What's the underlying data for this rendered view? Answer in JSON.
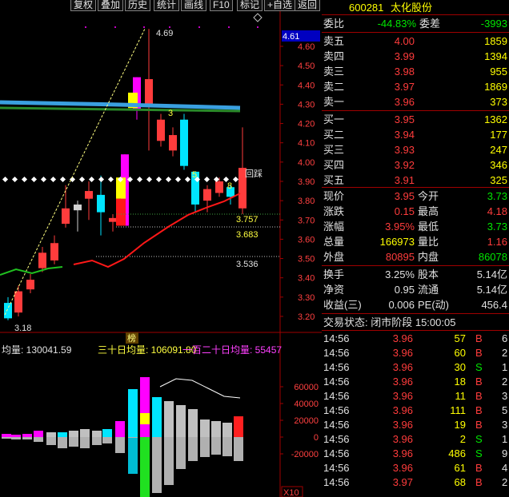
{
  "toolbar": {
    "buttons": [
      "复权",
      "叠加",
      "历史",
      "统计",
      "画线",
      "F10",
      "标记",
      "+自选",
      "返回"
    ]
  },
  "stock": {
    "code": "600281",
    "name": "太化股份",
    "zoom_badge": "4.61"
  },
  "chart": {
    "price_ticks": [
      "4.60",
      "4.50",
      "4.40",
      "4.30",
      "4.20",
      "4.10",
      "4.00",
      "3.90",
      "3.80",
      "3.70",
      "3.60",
      "3.50",
      "3.40",
      "3.30",
      "3.20"
    ],
    "annot_high": "4.69",
    "annot_low": "3.18",
    "annot_levels": [
      "3.757",
      "3.683",
      "3.536"
    ],
    "annot_counts": [
      "3",
      "5",
      "8"
    ],
    "annot_retest": "回踩",
    "marker": "榜",
    "volume_header": {
      "avg_label": "均量: 130041.59",
      "avg30_label": "三十日均量: 106091.80",
      "avg120_label": "一百二十日均量: 55457"
    },
    "volume_ticks": [
      "60000",
      "40000",
      "20000",
      "0",
      "-20000"
    ],
    "scale_badge": "X10"
  },
  "quote": {
    "weibi_label": "委比",
    "weibi_value": "-44.83%",
    "weicha_label": "委差",
    "weicha_value": "-3993",
    "asks": [
      {
        "label": "卖五",
        "price": "4.00",
        "vol": "1859"
      },
      {
        "label": "卖四",
        "price": "3.99",
        "vol": "1394"
      },
      {
        "label": "卖三",
        "price": "3.98",
        "vol": "955"
      },
      {
        "label": "卖二",
        "price": "3.97",
        "vol": "1869"
      },
      {
        "label": "卖一",
        "price": "3.96",
        "vol": "373"
      }
    ],
    "bids": [
      {
        "label": "买一",
        "price": "3.95",
        "vol": "1362"
      },
      {
        "label": "买二",
        "price": "3.94",
        "vol": "177"
      },
      {
        "label": "买三",
        "price": "3.93",
        "vol": "247"
      },
      {
        "label": "买四",
        "price": "3.92",
        "vol": "346"
      },
      {
        "label": "买五",
        "price": "3.91",
        "vol": "325"
      }
    ],
    "stats": [
      {
        "l1": "现价",
        "v1": "3.95",
        "l2": "今开",
        "v2": "3.73"
      },
      {
        "l1": "涨跌",
        "v1": "0.15",
        "l2": "最高",
        "v2": "4.18"
      },
      {
        "l1": "涨幅",
        "v1": "3.95%",
        "l2": "最低",
        "v2": "3.73"
      },
      {
        "l1": "总量",
        "v1": "166973",
        "l2": "量比",
        "v2": "1.16"
      },
      {
        "l1": "外盘",
        "v1": "80895",
        "l2": "内盘",
        "v2": "86078"
      }
    ],
    "fund": [
      {
        "l1": "换手",
        "v1": "3.25%",
        "l2": "股本",
        "v2": "5.14亿"
      },
      {
        "l1": "净资",
        "v1": "0.95",
        "l2": "流通",
        "v2": "5.14亿"
      },
      {
        "l1": "收益(三)",
        "v1": "0.006",
        "l2": "PE(动)",
        "v2": "456.4"
      }
    ],
    "trade_status_label": "交易状态: 闭市阶段 15:00:05",
    "ticks": [
      {
        "t": "14:56",
        "p": "3.96",
        "v": "57",
        "s": "B",
        "n": "6"
      },
      {
        "t": "14:56",
        "p": "3.96",
        "v": "60",
        "s": "B",
        "n": "2"
      },
      {
        "t": "14:56",
        "p": "3.96",
        "v": "30",
        "s": "S",
        "n": "1"
      },
      {
        "t": "14:56",
        "p": "3.96",
        "v": "18",
        "s": "B",
        "n": "2"
      },
      {
        "t": "14:56",
        "p": "3.96",
        "v": "11",
        "s": "B",
        "n": "3"
      },
      {
        "t": "14:56",
        "p": "3.96",
        "v": "111",
        "s": "B",
        "n": "5"
      },
      {
        "t": "14:56",
        "p": "3.96",
        "v": "19",
        "s": "B",
        "n": "3"
      },
      {
        "t": "14:56",
        "p": "3.96",
        "v": "2",
        "s": "S",
        "n": "1"
      },
      {
        "t": "14:56",
        "p": "3.96",
        "v": "486",
        "s": "S",
        "n": "9"
      },
      {
        "t": "14:56",
        "p": "3.96",
        "v": "61",
        "s": "B",
        "n": "4"
      },
      {
        "t": "14:56",
        "p": "3.97",
        "v": "68",
        "s": "B",
        "n": "2"
      }
    ]
  },
  "colors": {
    "up": "#ff3c3c",
    "down": "#00e5ff",
    "ma": "#ff2020",
    "grid": "#8b0000",
    "bg": "#000000"
  }
}
